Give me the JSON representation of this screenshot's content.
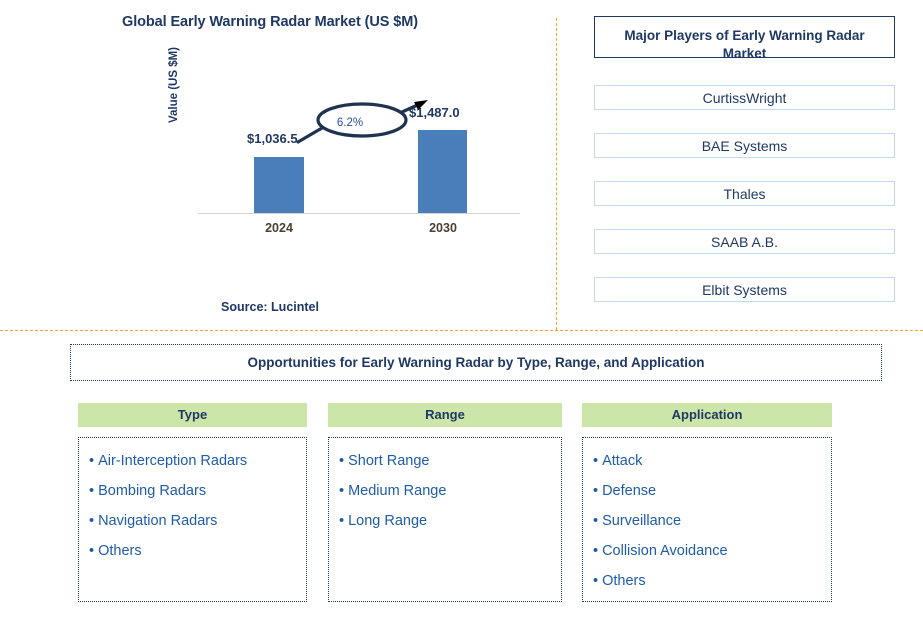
{
  "chart_panel": {
    "title": "Global Early Warning Radar Market (US $M)",
    "source": "Source: Lucintel"
  },
  "chart_data": {
    "type": "bar",
    "title": "Global Early Warning Radar Market (US $M)",
    "xlabel": "",
    "ylabel": "Value (US $M)",
    "categories": [
      "2024",
      "2030"
    ],
    "values": [
      1036.5,
      1487.0
    ],
    "value_labels": [
      "$1,036.5",
      "$1,487.0"
    ],
    "annotation": "6.2%",
    "annotation_type": "CAGR",
    "series": [
      {
        "name": "Value (US $M)",
        "values": [
          1036.5,
          1487.0
        ]
      }
    ],
    "ylim": [
      0,
      1700
    ],
    "grid": false,
    "legend": "none",
    "bar_color": "#4a7ebb",
    "source": "Source: Lucintel"
  },
  "players": {
    "header": "Major Players of Early Warning Radar Market",
    "items": [
      {
        "label": "CurtissWright"
      },
      {
        "label": "BAE Systems"
      },
      {
        "label": "Thales"
      },
      {
        "label": "SAAB A.B."
      },
      {
        "label": "Elbit Systems"
      }
    ]
  },
  "opportunities": {
    "banner": "Opportunities for Early Warning Radar by Type, Range, and Application",
    "columns": [
      {
        "header": "Type",
        "items": [
          "Air-Interception Radars",
          "Bombing Radars",
          "Navigation Radars",
          "Others"
        ]
      },
      {
        "header": "Range",
        "items": [
          "Short Range",
          "Medium Range",
          "Long Range"
        ]
      },
      {
        "header": "Application",
        "items": [
          "Attack",
          "Defense",
          "Surveillance",
          "Collision Avoidance",
          "Others"
        ]
      }
    ]
  },
  "colors": {
    "navy": "#1f3864",
    "bar_blue": "#4a7ebb",
    "divider_orange": "#f5a623",
    "header_green": "#cce5a8",
    "list_blue": "#1f5ca8",
    "player_border": "#c5dcf0"
  },
  "bullet": "•"
}
